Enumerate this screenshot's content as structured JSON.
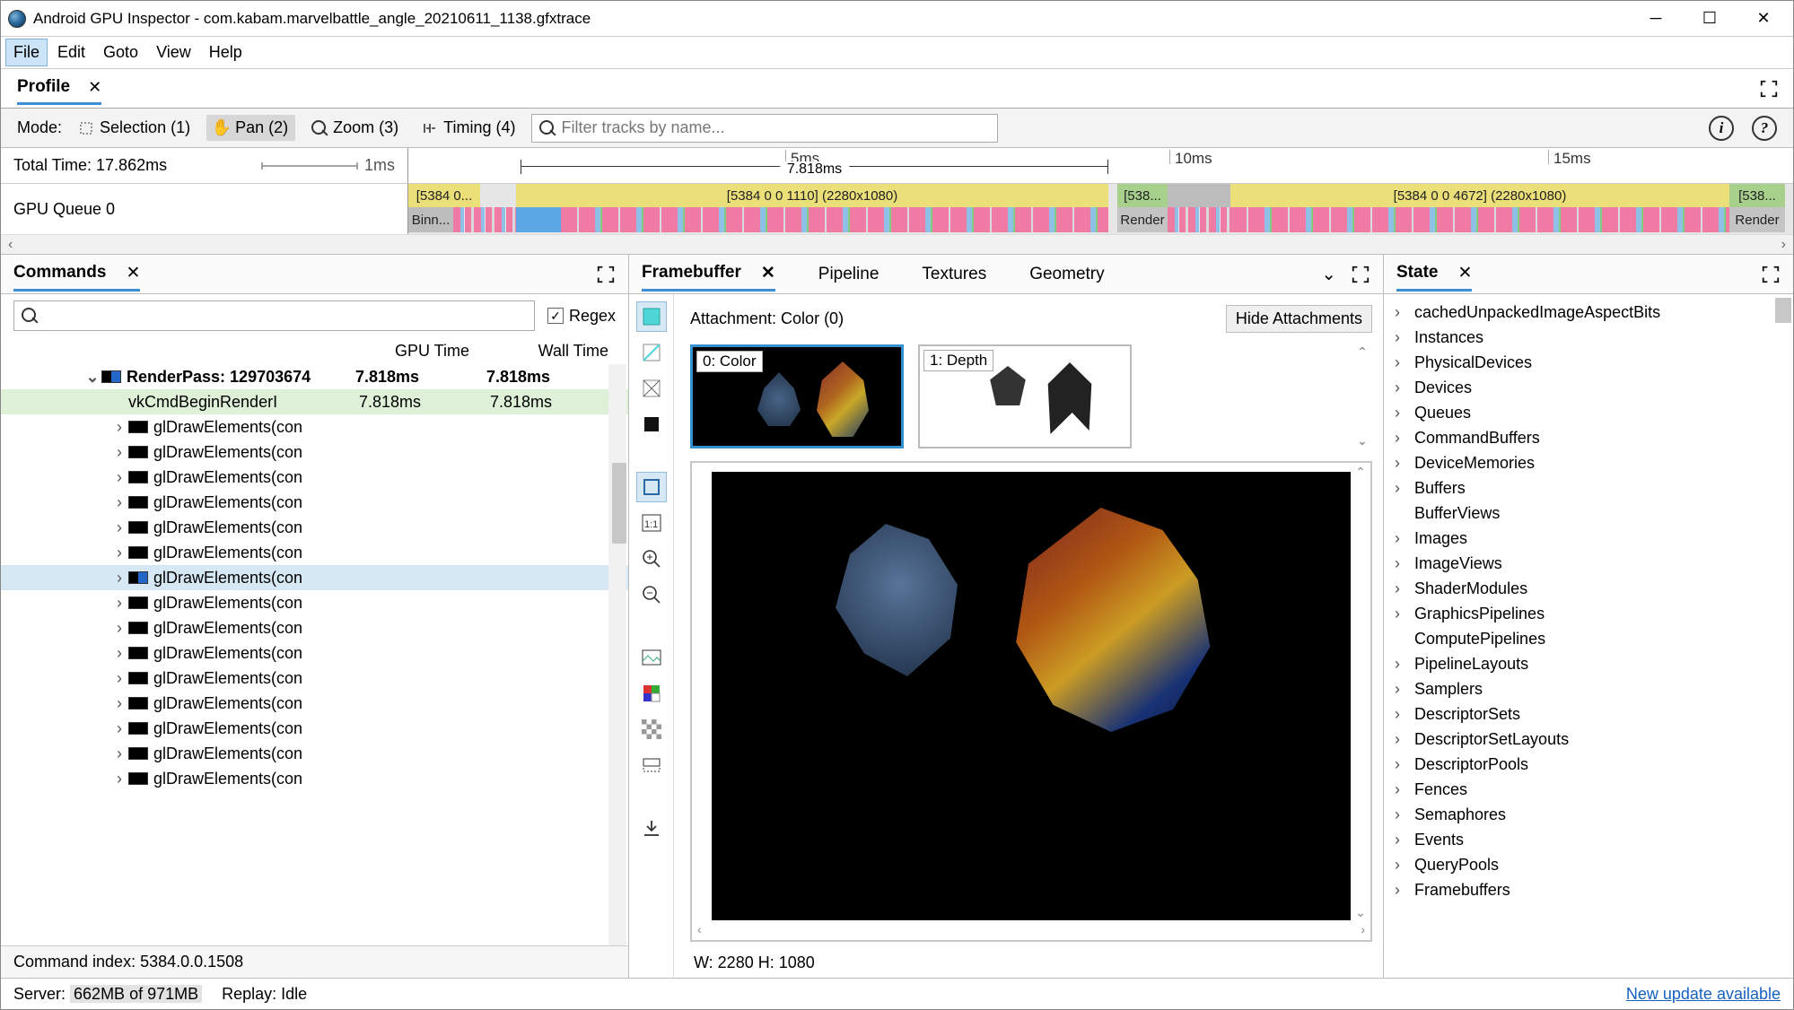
{
  "titlebar": {
    "title": "Android GPU Inspector - com.kabam.marvelbattle_angle_20210611_1138.gfxtrace"
  },
  "menubar": [
    "File",
    "Edit",
    "Goto",
    "View",
    "Help"
  ],
  "profile_tab": "Profile",
  "mode": {
    "label": "Mode:",
    "selection": "Selection (1)",
    "pan": "Pan (2)",
    "zoom": "Zoom (3)",
    "timing": "Timing (4)",
    "filter_placeholder": "Filter tracks by name..."
  },
  "timeline": {
    "total_time": "Total Time: 17.862ms",
    "unit": "1ms",
    "ticks": [
      "5ms",
      "10ms",
      "15ms"
    ],
    "bracket": "7.818ms",
    "queue": "GPU Queue 0",
    "block0": "[5384 0...",
    "block0_sub": "Binn...",
    "block1": "[5384 0 0 1110] (2280x1080)",
    "block2": "[538...",
    "block2_r": "Render",
    "block3": "[5384 0 0 4672] (2280x1080)",
    "block4": "[538...",
    "block4_r": "Render"
  },
  "commands": {
    "title": "Commands",
    "regex": "Regex",
    "col_gpu": "GPU Time",
    "col_wall": "Wall Time",
    "rows": [
      {
        "chev": "⌄",
        "style": "lvl1",
        "swatch": "blue",
        "label": "RenderPass: 129703674",
        "t1": "7.818ms",
        "t2": "7.818ms"
      },
      {
        "chev": "",
        "style": "hi",
        "swatch": "",
        "label": "vkCmdBeginRenderI",
        "t1": "7.818ms",
        "t2": "7.818ms",
        "indent": 1
      },
      {
        "chev": "›",
        "style": "",
        "swatch": "black",
        "label": "glDrawElements(con",
        "indent": 1
      },
      {
        "chev": "›",
        "style": "",
        "swatch": "black",
        "label": "glDrawElements(con",
        "indent": 1
      },
      {
        "chev": "›",
        "style": "",
        "swatch": "black",
        "label": "glDrawElements(con",
        "indent": 1
      },
      {
        "chev": "›",
        "style": "",
        "swatch": "black",
        "label": "glDrawElements(con",
        "indent": 1
      },
      {
        "chev": "›",
        "style": "",
        "swatch": "black",
        "label": "glDrawElements(con",
        "indent": 1
      },
      {
        "chev": "›",
        "style": "",
        "swatch": "black",
        "label": "glDrawElements(con",
        "indent": 1
      },
      {
        "chev": "›",
        "style": "sel",
        "swatch": "blue",
        "label": "glDrawElements(con",
        "indent": 1
      },
      {
        "chev": "›",
        "style": "",
        "swatch": "black",
        "label": "glDrawElements(con",
        "indent": 1
      },
      {
        "chev": "›",
        "style": "",
        "swatch": "black",
        "label": "glDrawElements(con",
        "indent": 1
      },
      {
        "chev": "›",
        "style": "",
        "swatch": "black",
        "label": "glDrawElements(con",
        "indent": 1
      },
      {
        "chev": "›",
        "style": "",
        "swatch": "black",
        "label": "glDrawElements(con",
        "indent": 1
      },
      {
        "chev": "›",
        "style": "",
        "swatch": "black",
        "label": "glDrawElements(con",
        "indent": 1
      },
      {
        "chev": "›",
        "style": "",
        "swatch": "black",
        "label": "glDrawElements(con",
        "indent": 1
      },
      {
        "chev": "›",
        "style": "",
        "swatch": "black",
        "label": "glDrawElements(con",
        "indent": 1
      },
      {
        "chev": "›",
        "style": "",
        "swatch": "black",
        "label": "glDrawElements(con",
        "indent": 1
      }
    ],
    "footer": "Command index: 5384.0.0.1508"
  },
  "framebuffer": {
    "tabs": [
      "Framebuffer",
      "Pipeline",
      "Textures",
      "Geometry"
    ],
    "attachment": "Attachment: Color (0)",
    "hide": "Hide Attachments",
    "thumb0": "0: Color",
    "thumb1": "1: Depth",
    "dim": "W: 2280 H: 1080"
  },
  "state": {
    "title": "State",
    "items": [
      {
        "chev": "›",
        "label": "cachedUnpackedImageAspectBits"
      },
      {
        "chev": "›",
        "label": "Instances"
      },
      {
        "chev": "›",
        "label": "PhysicalDevices"
      },
      {
        "chev": "›",
        "label": "Devices"
      },
      {
        "chev": "›",
        "label": "Queues"
      },
      {
        "chev": "›",
        "label": "CommandBuffers"
      },
      {
        "chev": "›",
        "label": "DeviceMemories"
      },
      {
        "chev": "›",
        "label": "Buffers"
      },
      {
        "chev": "",
        "label": "BufferViews"
      },
      {
        "chev": "›",
        "label": "Images"
      },
      {
        "chev": "›",
        "label": "ImageViews"
      },
      {
        "chev": "›",
        "label": "ShaderModules"
      },
      {
        "chev": "›",
        "label": "GraphicsPipelines"
      },
      {
        "chev": "",
        "label": "ComputePipelines"
      },
      {
        "chev": "›",
        "label": "PipelineLayouts"
      },
      {
        "chev": "›",
        "label": "Samplers"
      },
      {
        "chev": "›",
        "label": "DescriptorSets"
      },
      {
        "chev": "›",
        "label": "DescriptorSetLayouts"
      },
      {
        "chev": "›",
        "label": "DescriptorPools"
      },
      {
        "chev": "›",
        "label": "Fences"
      },
      {
        "chev": "›",
        "label": "Semaphores"
      },
      {
        "chev": "›",
        "label": "Events"
      },
      {
        "chev": "›",
        "label": "QueryPools"
      },
      {
        "chev": "›",
        "label": "Framebuffers"
      }
    ]
  },
  "status": {
    "server_pre": "Server: ",
    "server_mem": "662MB of 971MB",
    "replay": "Replay: Idle",
    "update": "New update available"
  },
  "info": "i",
  "help": "?"
}
